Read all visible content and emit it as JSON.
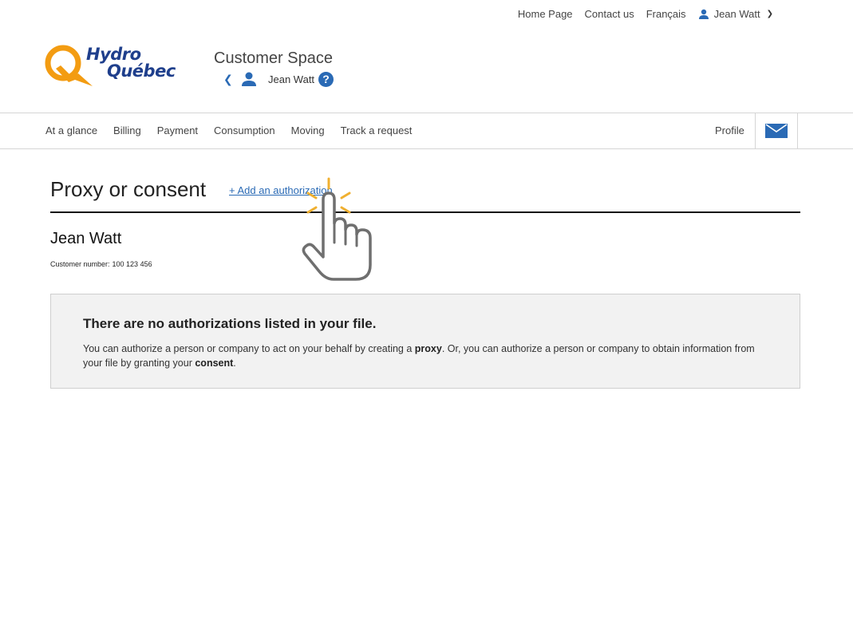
{
  "top_links": {
    "home": "Home Page",
    "contact": "Contact us",
    "language": "Français",
    "user": "Jean Watt"
  },
  "logo": {
    "line1": "Hydro",
    "line2": "Québec"
  },
  "customer_space": {
    "title": "Customer Space",
    "user": "Jean Watt",
    "help": "?"
  },
  "nav": {
    "items": [
      "At a glance",
      "Billing",
      "Payment",
      "Consumption",
      "Moving",
      "Track a request"
    ],
    "profile": "Profile"
  },
  "main": {
    "title": "Proxy or consent",
    "add_link": "+ Add an authorization",
    "customer_name": "Jean Watt",
    "customer_number_label": "Customer number:",
    "customer_number": "100 123 456"
  },
  "info": {
    "title": "There are no authorizations listed in your file.",
    "text_1": "You can authorize a person or company to act on your behalf by creating a ",
    "bold_1": "proxy",
    "text_2": ". Or, you can authorize a person or company to obtain information from your file by granting your ",
    "bold_2": "consent",
    "text_3": "."
  },
  "colors": {
    "brand_blue": "#1f3f8c",
    "link_blue": "#2a6ab5",
    "brand_orange": "#f39c12",
    "click_burst": "#f0b030"
  }
}
